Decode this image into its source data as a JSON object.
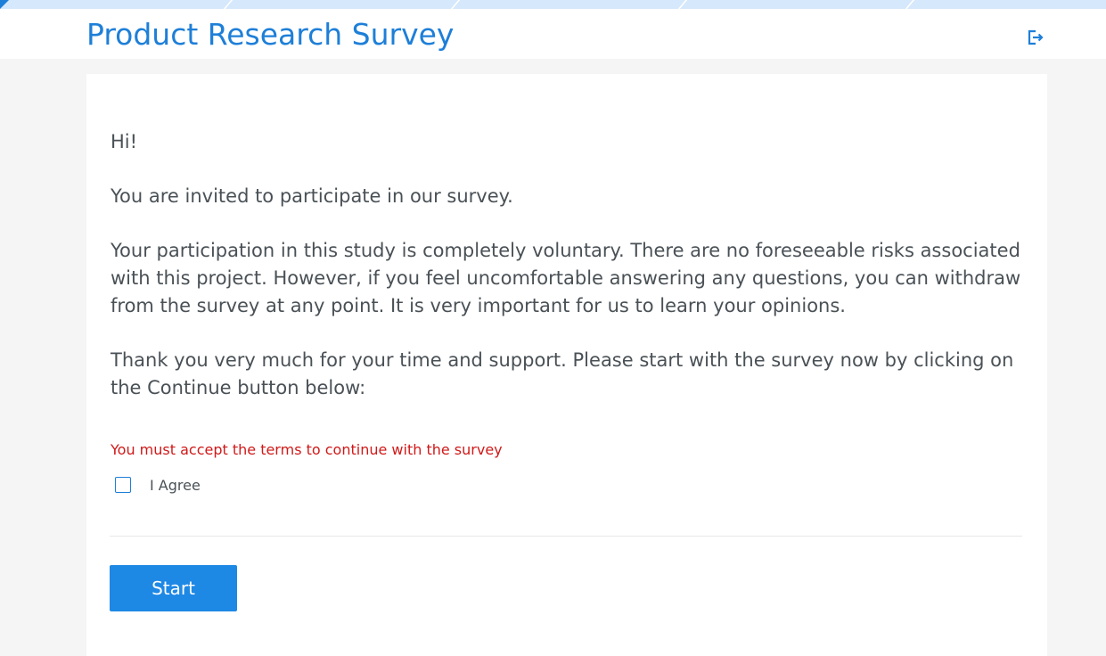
{
  "header": {
    "title": "Product Research Survey",
    "exit_icon": "sign-out-icon"
  },
  "theme": {
    "accent": "#1e7fd8",
    "button": "#1e88e5",
    "error": "#d01919",
    "text": "#4a5156",
    "page_bg": "#f5f5f5"
  },
  "intro": {
    "greeting": "Hi!",
    "invitation": "You are invited to participate in our survey.",
    "voluntary": "Your participation in this study is completely voluntary. There are no foreseeable risks associated with this project. However, if you feel uncomfortable answering any questions, you can withdraw from the survey at any point. It is very important for us to learn your opinions.",
    "thanks": "Thank you very much for your time and support. Please start with the survey now by clicking on the Continue button below:"
  },
  "terms": {
    "error_message": "You must accept the terms to continue with the survey",
    "agree_label": "I Agree",
    "checked": false
  },
  "actions": {
    "start_label": "Start"
  }
}
